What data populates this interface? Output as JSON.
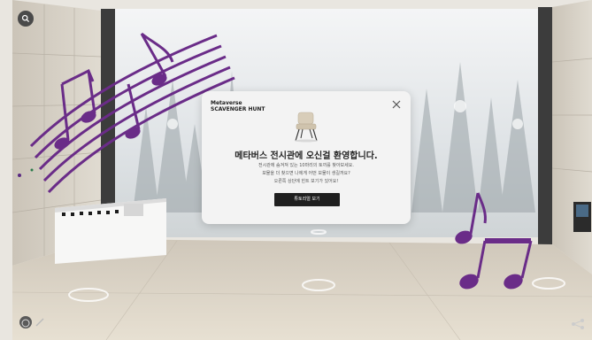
{
  "modal": {
    "brand_line1": "Metaverse",
    "brand_line2": "SCAVENGER HUNT",
    "title": "메타버스 전시관에 오신걸 환영합니다.",
    "body": [
      "전시관에 숨겨져 있는 10마리의 토끼를 찾아보세요.",
      "보물을 더 찾으면 나에게 어떤 보물이 생길까요?",
      "오른쪽 상단에 힌트 보기가 있어요!"
    ],
    "cta_label": "튜토리얼 보기"
  },
  "icons": {
    "map": "map-pin-icon",
    "close": "close-icon",
    "chair": "chair-icon",
    "music_notes": "music-notes-icon",
    "share": "share-icon"
  },
  "colors": {
    "music_notes": "#6a2c88",
    "modal_bg": "#f3f3f3",
    "button_bg": "#1f1f1f"
  }
}
